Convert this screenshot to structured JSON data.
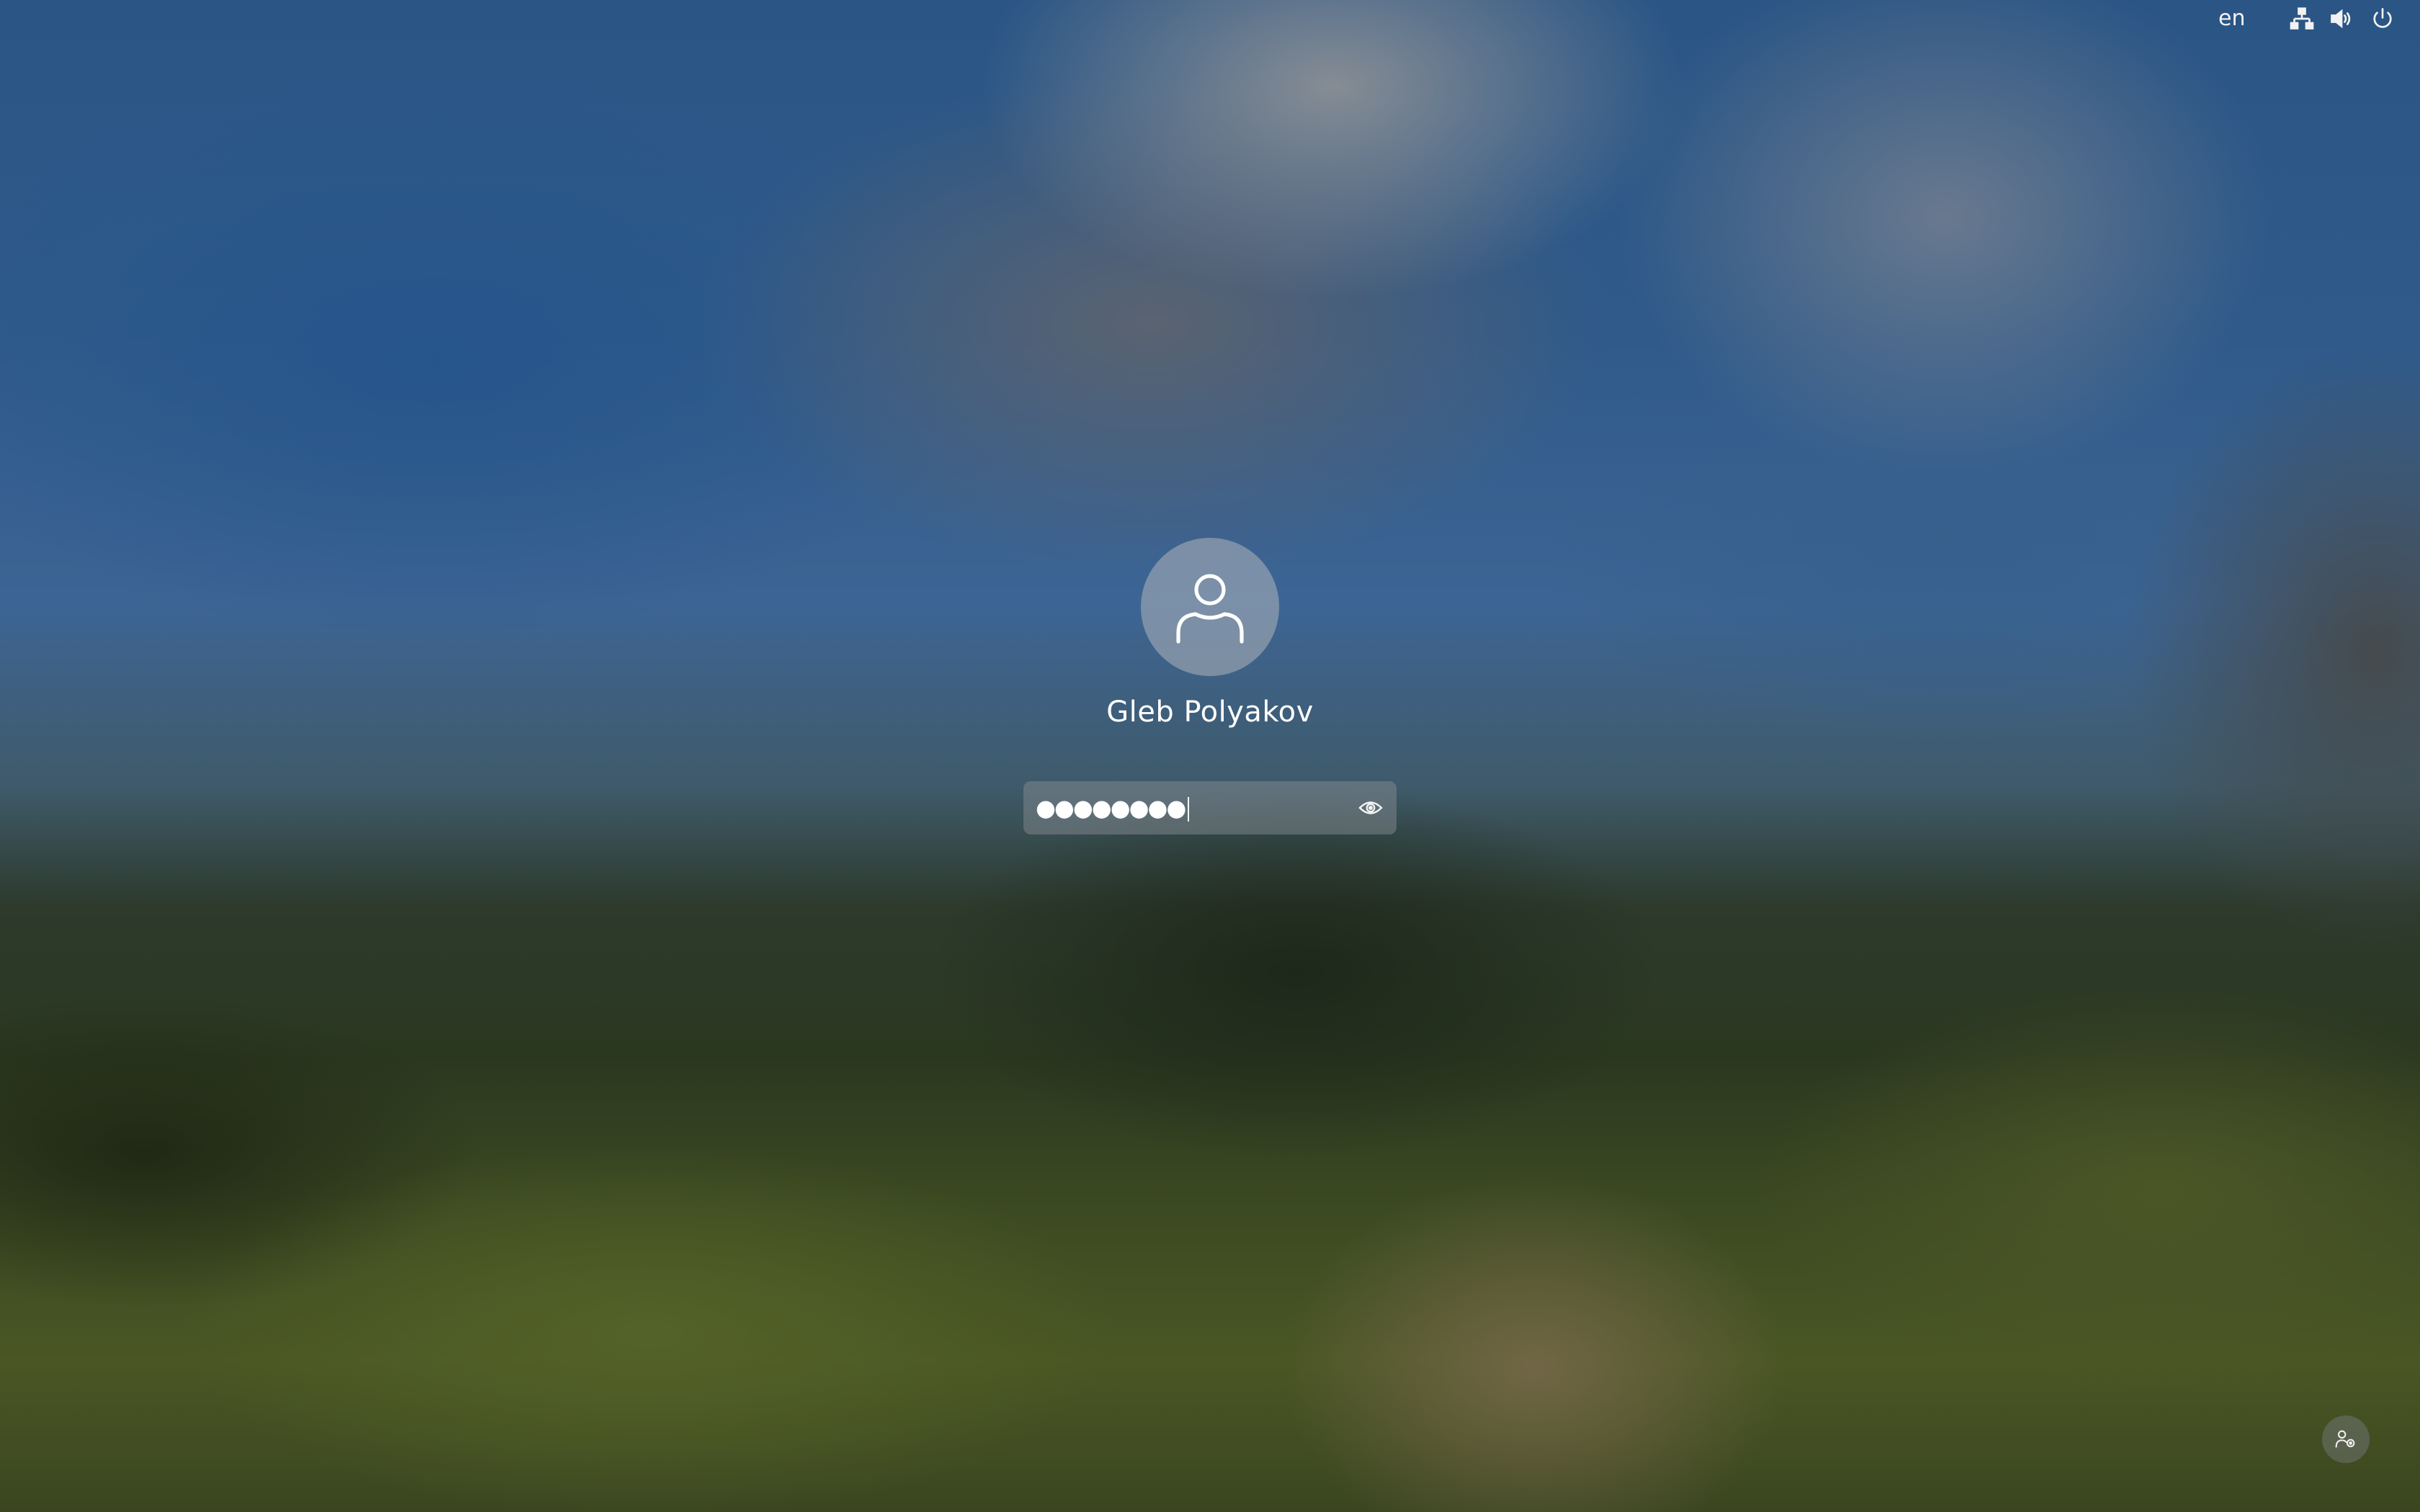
{
  "top_panel": {
    "keyboard_layout": "en",
    "icons": [
      "network-icon",
      "volume-icon",
      "power-icon"
    ]
  },
  "login": {
    "user_name": "Gleb Polyakov",
    "avatar_icon": "user-avatar-icon",
    "password_masked": "●●●●●●●●",
    "password_length": 8,
    "show_password_icon": "eye-icon"
  },
  "bottom_right": {
    "icon": "user-accessibility-icon"
  },
  "colors": {
    "text": "#ffffff",
    "field_background": "rgba(140,145,150,0.45)",
    "avatar_background": "rgba(175,180,185,0.55)"
  }
}
